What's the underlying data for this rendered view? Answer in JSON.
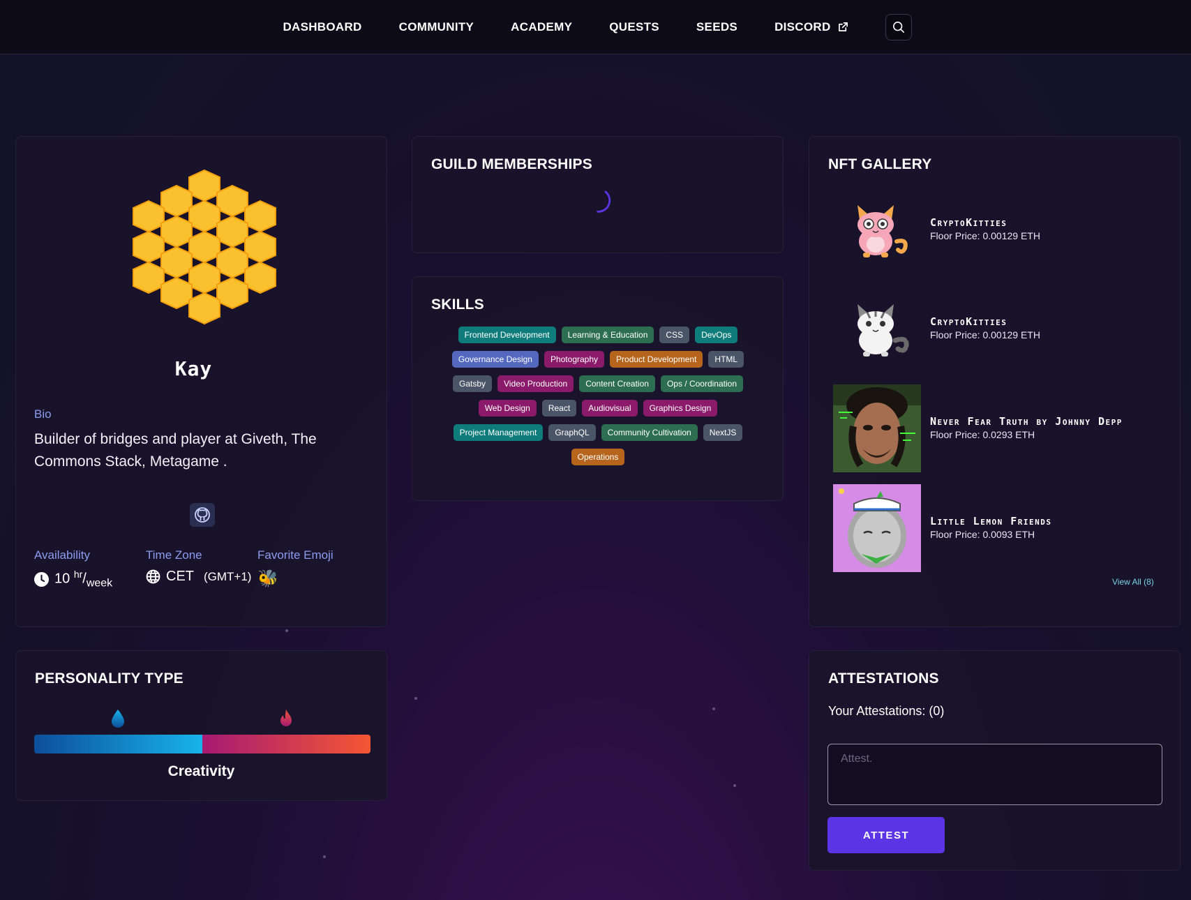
{
  "nav": {
    "items": [
      "DASHBOARD",
      "COMMUNITY",
      "ACADEMY",
      "QUESTS",
      "SEEDS",
      "DISCORD"
    ],
    "search_icon": "search-icon",
    "external_icon": "external-link-icon"
  },
  "profile": {
    "name": "Kay",
    "bio_label": "Bio",
    "bio": "Builder of bridges and player at Giveth, The Commons Stack, Metagame .",
    "social_icon": "github-icon",
    "availability_label": "Availability",
    "availability_value": "10",
    "availability_sup": "hr",
    "availability_sub": "week",
    "timezone_label": "Time Zone",
    "timezone_value": "CET",
    "timezone_offset": "(GMT+1)",
    "emoji_label": "Favorite Emoji",
    "emoji": "🐝"
  },
  "guild": {
    "title": "GUILD MEMBERSHIPS"
  },
  "skills": {
    "title": "SKILLS",
    "tags": [
      {
        "label": "Frontend Development",
        "color": "#0f7c7c"
      },
      {
        "label": "Learning & Education",
        "color": "#2c6e4f"
      },
      {
        "label": "CSS",
        "color": "#4a5568"
      },
      {
        "label": "DevOps",
        "color": "#0f7c7c"
      },
      {
        "label": "Governance Design",
        "color": "#5468c0"
      },
      {
        "label": "Photography",
        "color": "#8c1a6a"
      },
      {
        "label": "Product Development",
        "color": "#b7641d"
      },
      {
        "label": "HTML",
        "color": "#4a5568"
      },
      {
        "label": "Gatsby",
        "color": "#4a5568"
      },
      {
        "label": "Video Production",
        "color": "#8c1a6a"
      },
      {
        "label": "Content Creation",
        "color": "#2c6e4f"
      },
      {
        "label": "Ops / Coordination",
        "color": "#2c6e4f"
      },
      {
        "label": "Web Design",
        "color": "#8c1a6a"
      },
      {
        "label": "React",
        "color": "#4a5568"
      },
      {
        "label": "Audiovisual",
        "color": "#8c1a6a"
      },
      {
        "label": "Graphics Design",
        "color": "#8c1a6a"
      },
      {
        "label": "Project Management",
        "color": "#0f7c7c"
      },
      {
        "label": "GraphQL",
        "color": "#4a5568"
      },
      {
        "label": "Community Cultivation",
        "color": "#2c6e4f"
      },
      {
        "label": "NextJS",
        "color": "#4a5568"
      },
      {
        "label": "Operations",
        "color": "#b7641d"
      }
    ]
  },
  "nft": {
    "title": "NFT GALLERY",
    "items": [
      {
        "title": "CryptoKitties",
        "price": "Floor Price: 0.00129 ETH"
      },
      {
        "title": "CryptoKitties",
        "price": "Floor Price: 0.00129 ETH"
      },
      {
        "title": "Never Fear Truth by Johnny Depp",
        "price": "Floor Price: 0.0293 ETH"
      },
      {
        "title": "Little Lemon Friends",
        "price": "Floor Price: 0.0093 ETH"
      }
    ],
    "view_all": "View All (8)"
  },
  "personality": {
    "title": "PERSONALITY TYPE",
    "left_icon": "water-drop-icon",
    "right_icon": "fire-icon",
    "type": "Creativity"
  },
  "attestations": {
    "title": "ATTESTATIONS",
    "count_text": "Your Attestations: (0)",
    "placeholder": "Attest.",
    "button": "ATTEST"
  },
  "colors": {
    "accent": "#5b34e6",
    "label_blue": "#8b9df0",
    "link": "#7ad2e6",
    "honeycomb": "#fbc02d"
  }
}
